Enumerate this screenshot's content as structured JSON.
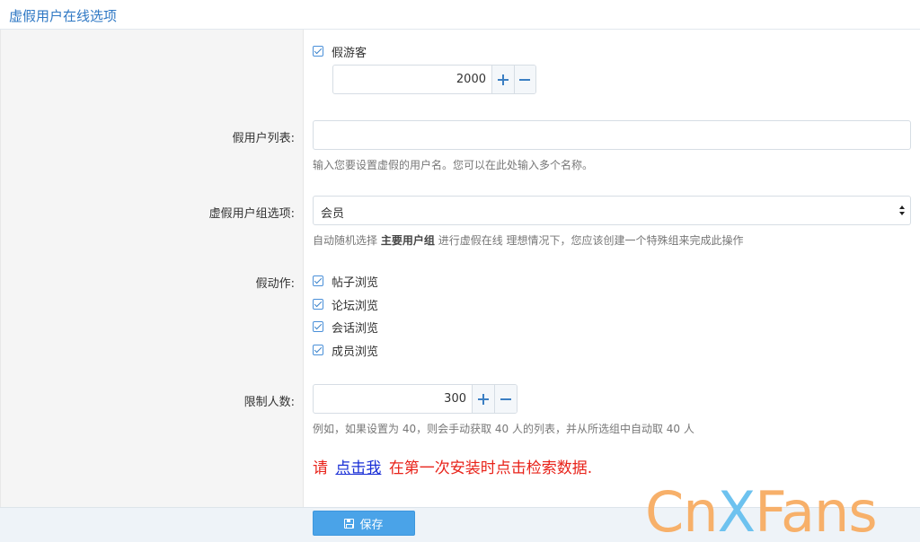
{
  "header": {
    "title": "虚假用户在线选项"
  },
  "fake_guest": {
    "checkbox_label": "假游客",
    "checked": true,
    "value": "2000"
  },
  "fake_user_list": {
    "label": "假用户列表:",
    "value": "",
    "help": "输入您要设置虚假的用户名。您可以在此处输入多个名称。"
  },
  "fake_user_group": {
    "label": "虚假用户组选项:",
    "selected": "会员",
    "help_prefix": "自动随机选择",
    "help_bold": "主要用户组",
    "help_suffix": "进行虚假在线 理想情况下，您应该创建一个特殊组来完成此操作"
  },
  "fake_actions": {
    "label": "假动作:",
    "items": [
      {
        "label": "帖子浏览",
        "checked": true
      },
      {
        "label": "论坛浏览",
        "checked": true
      },
      {
        "label": "会话浏览",
        "checked": true
      },
      {
        "label": "成员浏览",
        "checked": true
      }
    ]
  },
  "limit": {
    "label": "限制人数:",
    "value": "300",
    "help": "例如，如果设置为 40，则会手动获取 40 人的列表，并从所选组中自动取 40 人"
  },
  "notice": {
    "prefix": "请",
    "link": "点击我",
    "suffix": "在第一次安装时点击检索数据."
  },
  "footer": {
    "save_label": "保存"
  },
  "watermark": {
    "part1": "Cn",
    "part2": "X",
    "part3": "Fans"
  },
  "colors": {
    "accent": "#4aa3e8",
    "title": "#2f78c4",
    "notice": "#e8231a",
    "link": "#1a2fd6"
  },
  "icons": {
    "stepper_plus": "plus-icon",
    "stepper_minus": "minus-icon",
    "select_arrow": "updown-icon",
    "save": "floppy-icon"
  }
}
